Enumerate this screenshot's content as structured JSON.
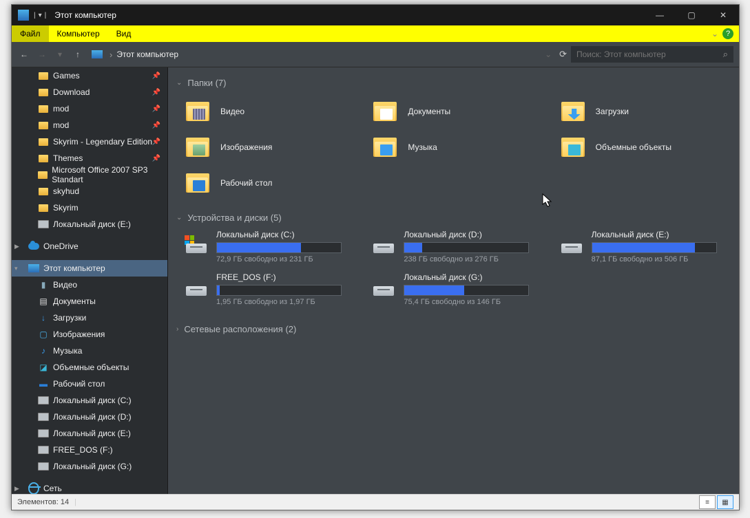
{
  "window": {
    "title": "Этот компьютер"
  },
  "ribbon": {
    "file": "Файл",
    "computer": "Компьютер",
    "view": "Вид"
  },
  "address": {
    "crumb": "Этот компьютер",
    "search_placeholder": "Поиск: Этот компьютер"
  },
  "sidebar": {
    "quick": [
      {
        "label": "Games",
        "pin": true,
        "icon": "folder"
      },
      {
        "label": "Download",
        "pin": true,
        "icon": "folder"
      },
      {
        "label": "mod",
        "pin": true,
        "icon": "folder"
      },
      {
        "label": "mod",
        "pin": true,
        "icon": "folder"
      },
      {
        "label": "Skyrim - Legendary Edition",
        "pin": true,
        "icon": "folder"
      },
      {
        "label": "Themes",
        "pin": true,
        "icon": "folder"
      },
      {
        "label": "Microsoft Office 2007 SP3 Standart",
        "pin": false,
        "icon": "folder"
      },
      {
        "label": "skyhud",
        "pin": false,
        "icon": "folder"
      },
      {
        "label": "Skyrim",
        "pin": false,
        "icon": "folder"
      },
      {
        "label": "Локальный диск (E:)",
        "pin": false,
        "icon": "drive"
      }
    ],
    "onedrive": "OneDrive",
    "thispc": "Этот компьютер",
    "pc_children": [
      {
        "label": "Видео",
        "icon": "video"
      },
      {
        "label": "Документы",
        "icon": "doc"
      },
      {
        "label": "Загрузки",
        "icon": "dl"
      },
      {
        "label": "Изображения",
        "icon": "img"
      },
      {
        "label": "Музыка",
        "icon": "mus"
      },
      {
        "label": "Объемные объекты",
        "icon": "3d"
      },
      {
        "label": "Рабочий стол",
        "icon": "desk"
      },
      {
        "label": "Локальный диск (C:)",
        "icon": "drive"
      },
      {
        "label": "Локальный диск (D:)",
        "icon": "drive"
      },
      {
        "label": "Локальный диск (E:)",
        "icon": "drive"
      },
      {
        "label": "FREE_DOS (F:)",
        "icon": "drive"
      },
      {
        "label": "Локальный диск (G:)",
        "icon": "drive"
      }
    ],
    "network": "Сеть"
  },
  "groups": {
    "folders": {
      "title": "Папки (7)",
      "items": [
        {
          "label": "Видео",
          "ov": "ov-video"
        },
        {
          "label": "Документы",
          "ov": "ov-doc"
        },
        {
          "label": "Загрузки",
          "ov": "ov-dl"
        },
        {
          "label": "Изображения",
          "ov": "ov-img"
        },
        {
          "label": "Музыка",
          "ov": "ov-mus"
        },
        {
          "label": "Объемные объекты",
          "ov": "ov-3d"
        },
        {
          "label": "Рабочий стол",
          "ov": "ov-desk"
        }
      ]
    },
    "drives": {
      "title": "Устройства и диски (5)",
      "items": [
        {
          "name": "Локальный диск (C:)",
          "free": "72,9 ГБ свободно из 231 ГБ",
          "pct": 68,
          "os": true
        },
        {
          "name": "Локальный диск (D:)",
          "free": "238 ГБ свободно из 276 ГБ",
          "pct": 14
        },
        {
          "name": "Локальный диск (E:)",
          "free": "87,1 ГБ свободно из 506 ГБ",
          "pct": 83
        },
        {
          "name": "FREE_DOS (F:)",
          "free": "1,95 ГБ свободно из 1,97 ГБ",
          "pct": 2
        },
        {
          "name": "Локальный диск (G:)",
          "free": "75,4 ГБ свободно из 146 ГБ",
          "pct": 48
        }
      ]
    },
    "network": {
      "title": "Сетевые расположения (2)"
    }
  },
  "status": {
    "items": "Элементов: 14"
  }
}
